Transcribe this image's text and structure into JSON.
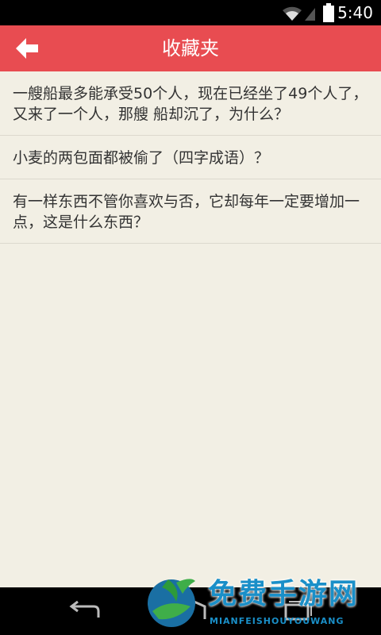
{
  "status_bar": {
    "time": "5:40"
  },
  "header": {
    "title": "收藏夹"
  },
  "list": {
    "items": [
      {
        "text": "一艘船最多能承受50个人，现在已经坐了49个人了，又来了一个人，那艘 船却沉了，为什么？"
      },
      {
        "text": "小麦的两包面都被偷了（四字成语）？"
      },
      {
        "text": "有一样东西不管你喜欢与否，它却每年一定要增加一点，这是什么东西？"
      }
    ]
  },
  "watermark": {
    "title": "免费手游网",
    "subtitle": "MIANFEISHOUYOUWANG"
  },
  "colors": {
    "header": "#e84c51",
    "background": "#f2efe4",
    "text": "#333333"
  }
}
